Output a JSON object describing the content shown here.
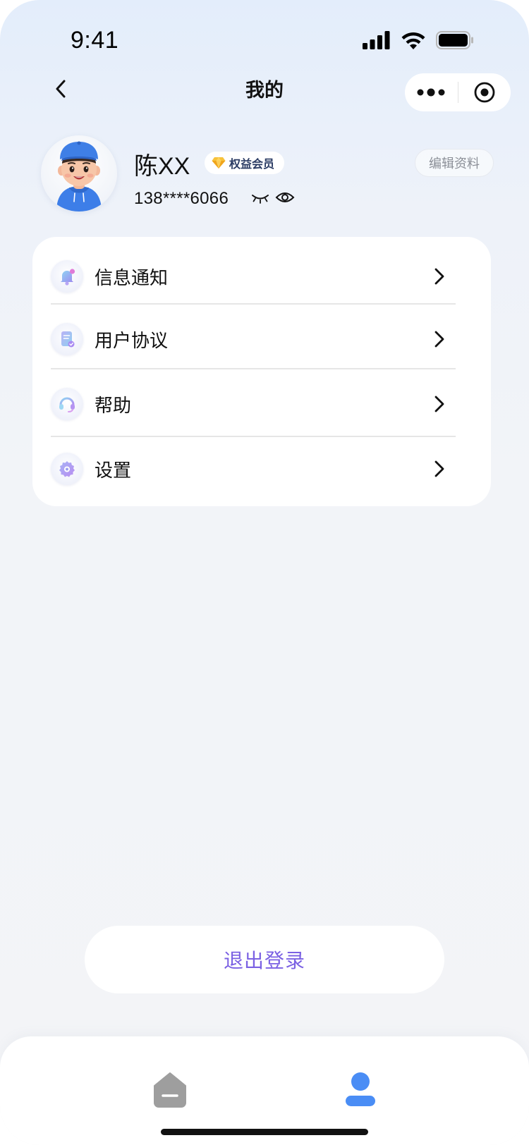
{
  "status_bar": {
    "time": "9:41",
    "icons": [
      "signal-icon",
      "wifi-icon",
      "battery-icon"
    ]
  },
  "nav": {
    "back_icon": "chevron-left-icon",
    "title": "我的",
    "capsule_icons": [
      "more-icon",
      "close-target-icon"
    ]
  },
  "profile": {
    "name": "陈XX",
    "badge": "权益会员",
    "badge_icon": "diamond-icon",
    "phone": "138****6066",
    "edit_label": "编辑资料"
  },
  "menu": {
    "items": [
      {
        "label": "信息通知",
        "icon": "bell-icon"
      },
      {
        "label": "用户协议",
        "icon": "document-icon"
      },
      {
        "label": "帮助",
        "icon": "headset-icon"
      },
      {
        "label": "设置",
        "icon": "gear-icon"
      }
    ]
  },
  "logout_label": "退出登录",
  "tab_bar": {
    "tabs": [
      {
        "icon": "home-icon",
        "active": false
      },
      {
        "icon": "user-icon",
        "active": true
      }
    ]
  },
  "colors": {
    "accent_purple": "#7b61e3",
    "active_tab": "#4a8df5",
    "inactive_tab": "#9e9e9e"
  }
}
